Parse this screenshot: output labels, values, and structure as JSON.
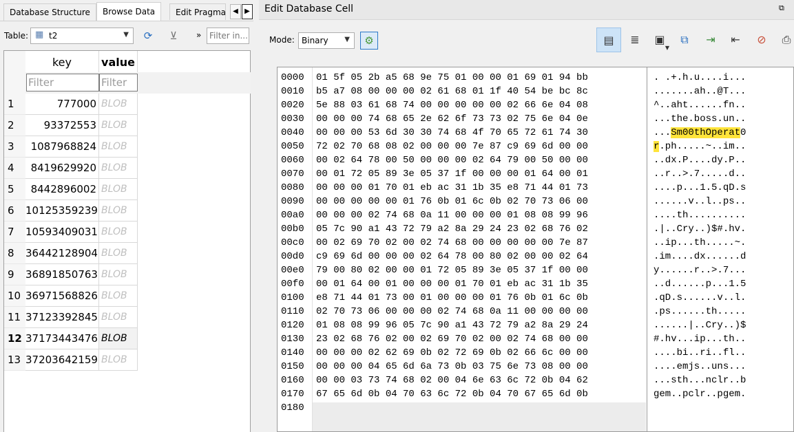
{
  "tabs": {
    "database_structure": "Database Structure",
    "browse_data": "Browse Data",
    "edit_pragmas": "Edit Pragmas",
    "arrow_left": "◀",
    "arrow_right": "▶"
  },
  "browse": {
    "table_label": "Table:",
    "table_value": "t2",
    "filter_all_placeholder": "Filter in...",
    "more": "»",
    "columns": {
      "key": "key",
      "value": "value"
    },
    "filter_placeholder": "Filter",
    "rows": [
      {
        "n": "1",
        "key": "777000",
        "value": "BLOB"
      },
      {
        "n": "2",
        "key": "93372553",
        "value": "BLOB"
      },
      {
        "n": "3",
        "key": "1087968824",
        "value": "BLOB"
      },
      {
        "n": "4",
        "key": "8419629920",
        "value": "BLOB"
      },
      {
        "n": "5",
        "key": "8442896002",
        "value": "BLOB"
      },
      {
        "n": "6",
        "key": "10125359239",
        "value": "BLOB"
      },
      {
        "n": "7",
        "key": "10593409031",
        "value": "BLOB"
      },
      {
        "n": "8",
        "key": "36442128904",
        "value": "BLOB"
      },
      {
        "n": "9",
        "key": "36891850763",
        "value": "BLOB"
      },
      {
        "n": "10",
        "key": "36971568826",
        "value": "BLOB"
      },
      {
        "n": "11",
        "key": "37123392845",
        "value": "BLOB"
      },
      {
        "n": "12",
        "key": "37173443476",
        "value": "BLOB"
      },
      {
        "n": "13",
        "key": "37203642159",
        "value": "BLOB"
      }
    ],
    "current_row": "12"
  },
  "edit_cell": {
    "title": "Edit Database Cell",
    "mode_label": "Mode:",
    "mode_value": "Binary",
    "hex_rows": [
      {
        "addr": "0000",
        "hex": "01 5f 05 2b a5 68 9e 75 01 00 00 01 69 01 94 bb",
        "ascii": ". .+.h.u....i..."
      },
      {
        "addr": "0010",
        "hex": "b5 a7 08 00 00 00 02 61 68 01 1f 40 54 be bc 8c",
        "ascii": ".......ah..@T..."
      },
      {
        "addr": "0020",
        "hex": "5e 88 03 61 68 74 00 00 00 00 00 02 66 6e 04 08",
        "ascii": "^..aht......fn.."
      },
      {
        "addr": "0030",
        "hex": "00 00 00 74 68 65 2e 62 6f 73 73 02 75 6e 04 0e",
        "ascii": "...the.boss.un.."
      },
      {
        "addr": "0040",
        "hex": "00 00 00 53 6d 30 30 74 68 4f 70 65 72 61 74 30",
        "ascii_pre": "...",
        "ascii_hl": "Sm00thOperat",
        "ascii_post": "0"
      },
      {
        "addr": "0050",
        "hex": "72 02 70 68 08 02 00 00 00 7e 87 c9 69 6d 00 00",
        "ascii_hl": "r",
        "ascii_post": ".ph.....~..im.."
      },
      {
        "addr": "0060",
        "hex": "00 02 64 78 00 50 00 00 00 02 64 79 00 50 00 00",
        "ascii": "..dx.P....dy.P.."
      },
      {
        "addr": "0070",
        "hex": "00 01 72 05 89 3e 05 37 1f 00 00 00 01 64 00 01",
        "ascii": "..r..>.7.....d.."
      },
      {
        "addr": "0080",
        "hex": "00 00 00 01 70 01 eb ac 31 1b 35 e8 71 44 01 73",
        "ascii": "....p...1.5.qD.s"
      },
      {
        "addr": "0090",
        "hex": "00 00 00 00 00 01 76 0b 01 6c 0b 02 70 73 06 00",
        "ascii": "......v..l..ps.."
      },
      {
        "addr": "00a0",
        "hex": "00 00 00 02 74 68 0a 11 00 00 00 01 08 08 99 96",
        "ascii": "....th.........."
      },
      {
        "addr": "00b0",
        "hex": "05 7c 90 a1 43 72 79 a2 8a 29 24 23 02 68 76 02",
        "ascii": ".|..Cry..)$#.hv."
      },
      {
        "addr": "00c0",
        "hex": "00 02 69 70 02 00 02 74 68 00 00 00 00 00 7e 87",
        "ascii": "..ip...th.....~."
      },
      {
        "addr": "00d0",
        "hex": "c9 69 6d 00 00 00 02 64 78 00 80 02 00 00 02 64",
        "ascii": ".im....dx......d"
      },
      {
        "addr": "00e0",
        "hex": "79 00 80 02 00 00 01 72 05 89 3e 05 37 1f 00 00",
        "ascii": "y......r..>.7..."
      },
      {
        "addr": "00f0",
        "hex": "00 01 64 00 01 00 00 00 01 70 01 eb ac 31 1b 35",
        "ascii": "..d......p...1.5"
      },
      {
        "addr": "0100",
        "hex": "e8 71 44 01 73 00 01 00 00 00 01 76 0b 01 6c 0b",
        "ascii": ".qD.s......v..l."
      },
      {
        "addr": "0110",
        "hex": "02 70 73 06 00 00 00 02 74 68 0a 11 00 00 00 00",
        "ascii": ".ps......th....."
      },
      {
        "addr": "0120",
        "hex": "01 08 08 99 96 05 7c 90 a1 43 72 79 a2 8a 29 24",
        "ascii": "......|..Cry..)$"
      },
      {
        "addr": "0130",
        "hex": "23 02 68 76 02 00 02 69 70 02 00 02 74 68 00 00",
        "ascii": "#.hv...ip...th.."
      },
      {
        "addr": "0140",
        "hex": "00 00 00 02 62 69 0b 02 72 69 0b 02 66 6c 00 00",
        "ascii": "....bi..ri..fl.."
      },
      {
        "addr": "0150",
        "hex": "00 00 00 04 65 6d 6a 73 0b 03 75 6e 73 08 00 00",
        "ascii": "....emjs..uns..."
      },
      {
        "addr": "0160",
        "hex": "00 00 03 73 74 68 02 00 04 6e 63 6c 72 0b 04 62",
        "ascii": "...sth...nclr..b"
      },
      {
        "addr": "0170",
        "hex": "67 65 6d 0b 04 70 63 6c 72 0b 04 70 67 65 6d 0b",
        "ascii": "gem..pclr..pgem."
      },
      {
        "addr": "0180",
        "hex": "",
        "ascii": ""
      }
    ]
  },
  "icons": {
    "table": "▦",
    "refresh": "⟳",
    "clear_filter": "⊻",
    "auto_format": "⚙",
    "float": "⧉",
    "text_mode": "▤",
    "word_wrap": "≣",
    "save_menu": "▣",
    "copy": "⧉",
    "import": "⇥",
    "export": "⇤",
    "set_null": "⊘",
    "print": "⎙"
  },
  "colors": {
    "highlight": "#ffe43a",
    "selection": "#cde3f7"
  }
}
